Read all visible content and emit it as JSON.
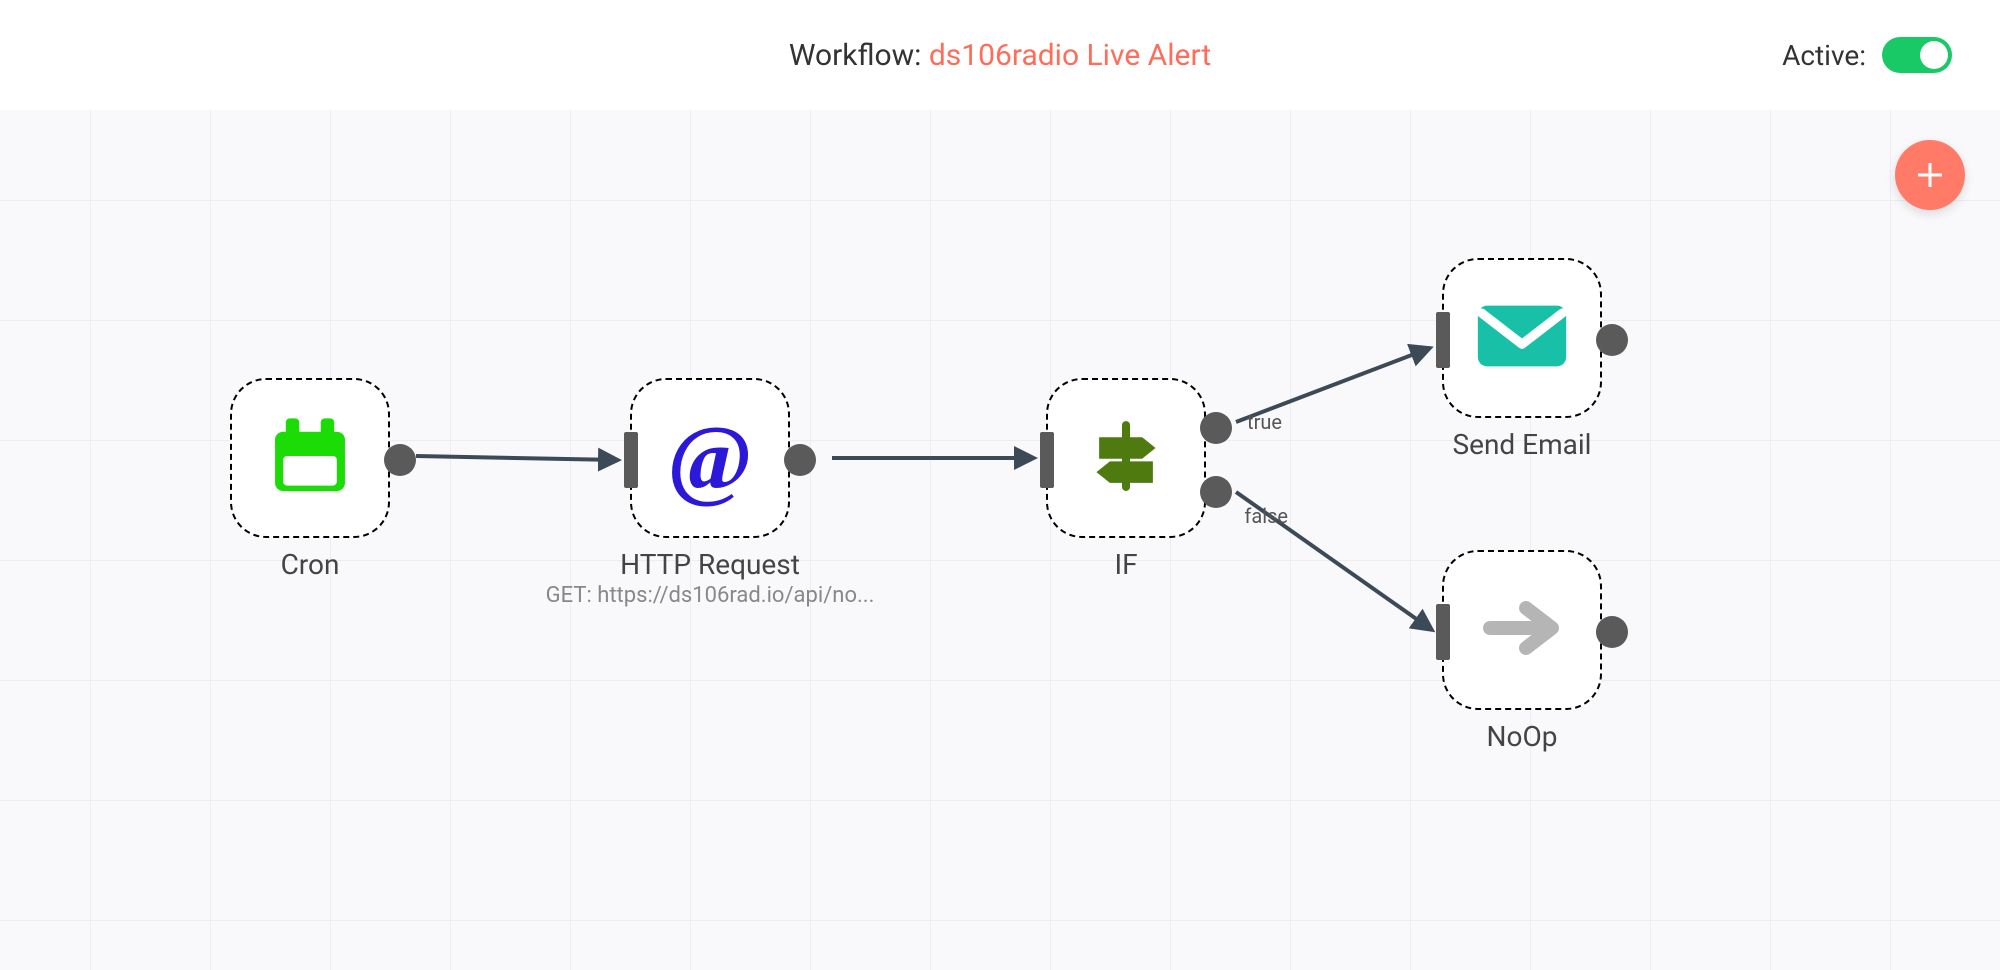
{
  "header": {
    "prefix": "Workflow: ",
    "name": "ds106radio Live Alert",
    "activeLabel": "Active:"
  },
  "nodes": {
    "cron": {
      "label": "Cron"
    },
    "http": {
      "label": "HTTP Request",
      "sublabel": "GET: https://ds106rad.io/api/no..."
    },
    "if": {
      "label": "IF",
      "trueLabel": "true",
      "falseLabel": "false"
    },
    "email": {
      "label": "Send Email"
    },
    "noop": {
      "label": "NoOp"
    }
  }
}
